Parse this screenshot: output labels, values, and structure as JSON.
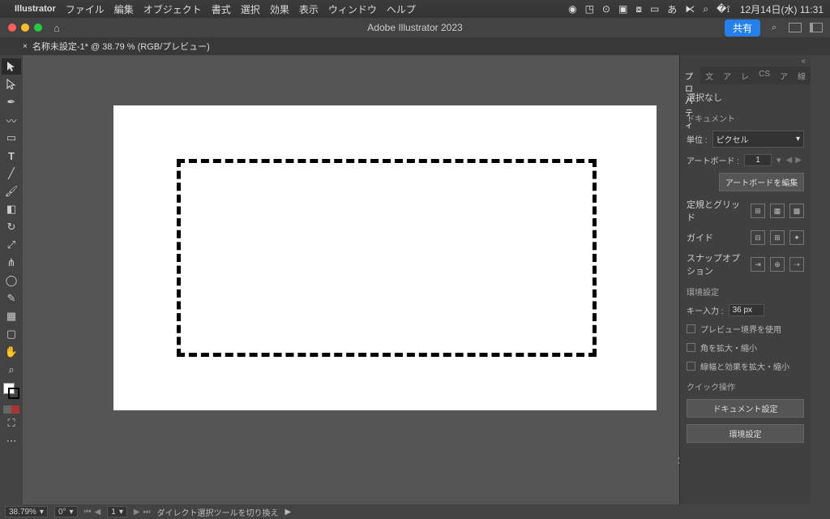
{
  "mac_menu": {
    "app": "Illustrator",
    "items": [
      "ファイル",
      "編集",
      "オブジェクト",
      "書式",
      "選択",
      "効果",
      "表示",
      "ウィンドウ",
      "ヘルプ"
    ],
    "clock": "12月14日(水)  11:31"
  },
  "titlebar": {
    "app_title": "Adobe Illustrator 2023",
    "share": "共有"
  },
  "doc_tab": {
    "label": "名称未設定-1* @ 38.79 % (RGB/プレビュー)"
  },
  "panel": {
    "tabs": [
      "プロパティ",
      "文字",
      "アート",
      "レイ",
      "CS",
      "アセ",
      "線"
    ],
    "tabs_short": [
      "プロパティ",
      "文",
      "ア",
      "レ",
      "CS",
      "ア",
      "線"
    ],
    "no_selection": "選択なし",
    "document_label": "ドキュメント",
    "unit_label": "単位 :",
    "unit_value": "ピクセル",
    "artboard_label": "アートボード :",
    "artboard_value": "1",
    "edit_artboard_btn": "アートボードを編集",
    "ruler_grid_label": "定規とグリッド",
    "guides_label": "ガイド",
    "snap_label": "スナップオプション",
    "prefs_label": "環境設定",
    "key_input_label": "キー入力 :",
    "key_input_value": "36 px",
    "chk_preview": "プレビュー境界を使用",
    "chk_scale_corner": "角を拡大・縮小",
    "chk_scale_stroke": "線幅と効果を拡大・縮小",
    "quick_label": "クイック操作",
    "doc_settings_btn": "ドキュメント設定",
    "env_settings_btn": "環境設定"
  },
  "statusbar": {
    "zoom": "38.79%",
    "rotate": "0°",
    "artboard": "1",
    "hint": "ダイレクト選択ツールを切り換え"
  }
}
